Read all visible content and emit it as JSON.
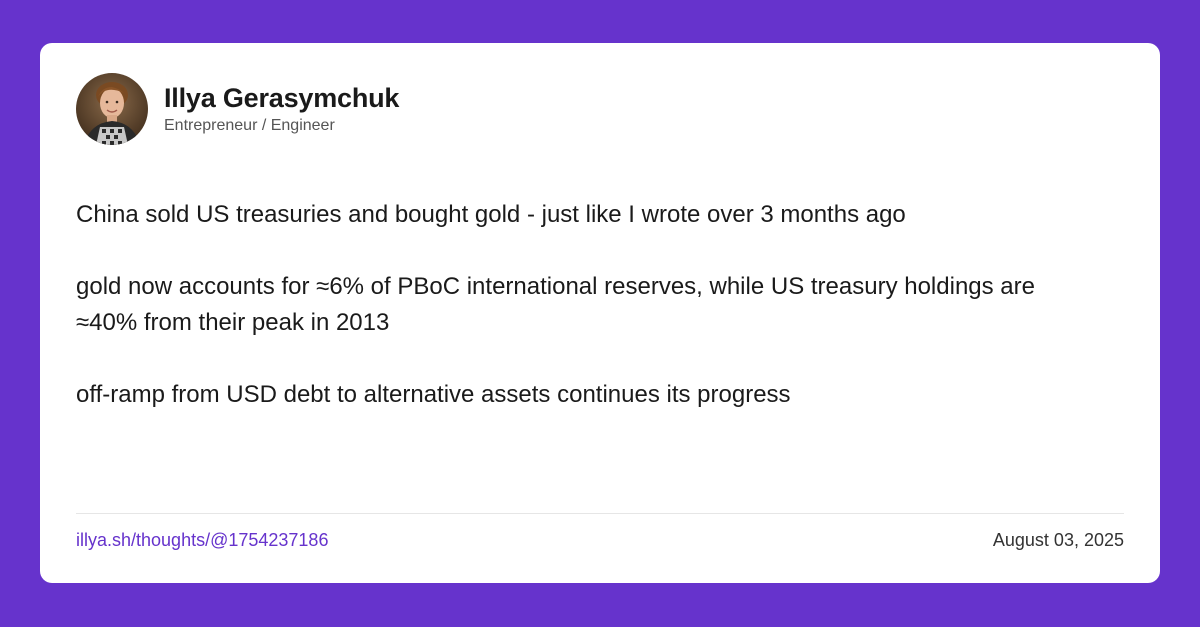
{
  "colors": {
    "background": "#6633cc",
    "card": "#ffffff",
    "accent": "#6633cc"
  },
  "author": {
    "name": "Illya Gerasymchuk",
    "title": "Entrepreneur / Engineer"
  },
  "post": {
    "paragraphs": [
      "China sold US treasuries and bought gold - just like I wrote over 3 months ago",
      "gold now accounts for ≈6% of PBoC international reserves, while US treasury holdings are ≈40% from their peak in 2013",
      "off-ramp from USD debt to alternative assets continues its progress"
    ]
  },
  "footer": {
    "link_text": "illya.sh/thoughts/@1754237186",
    "date": "August 03, 2025"
  }
}
